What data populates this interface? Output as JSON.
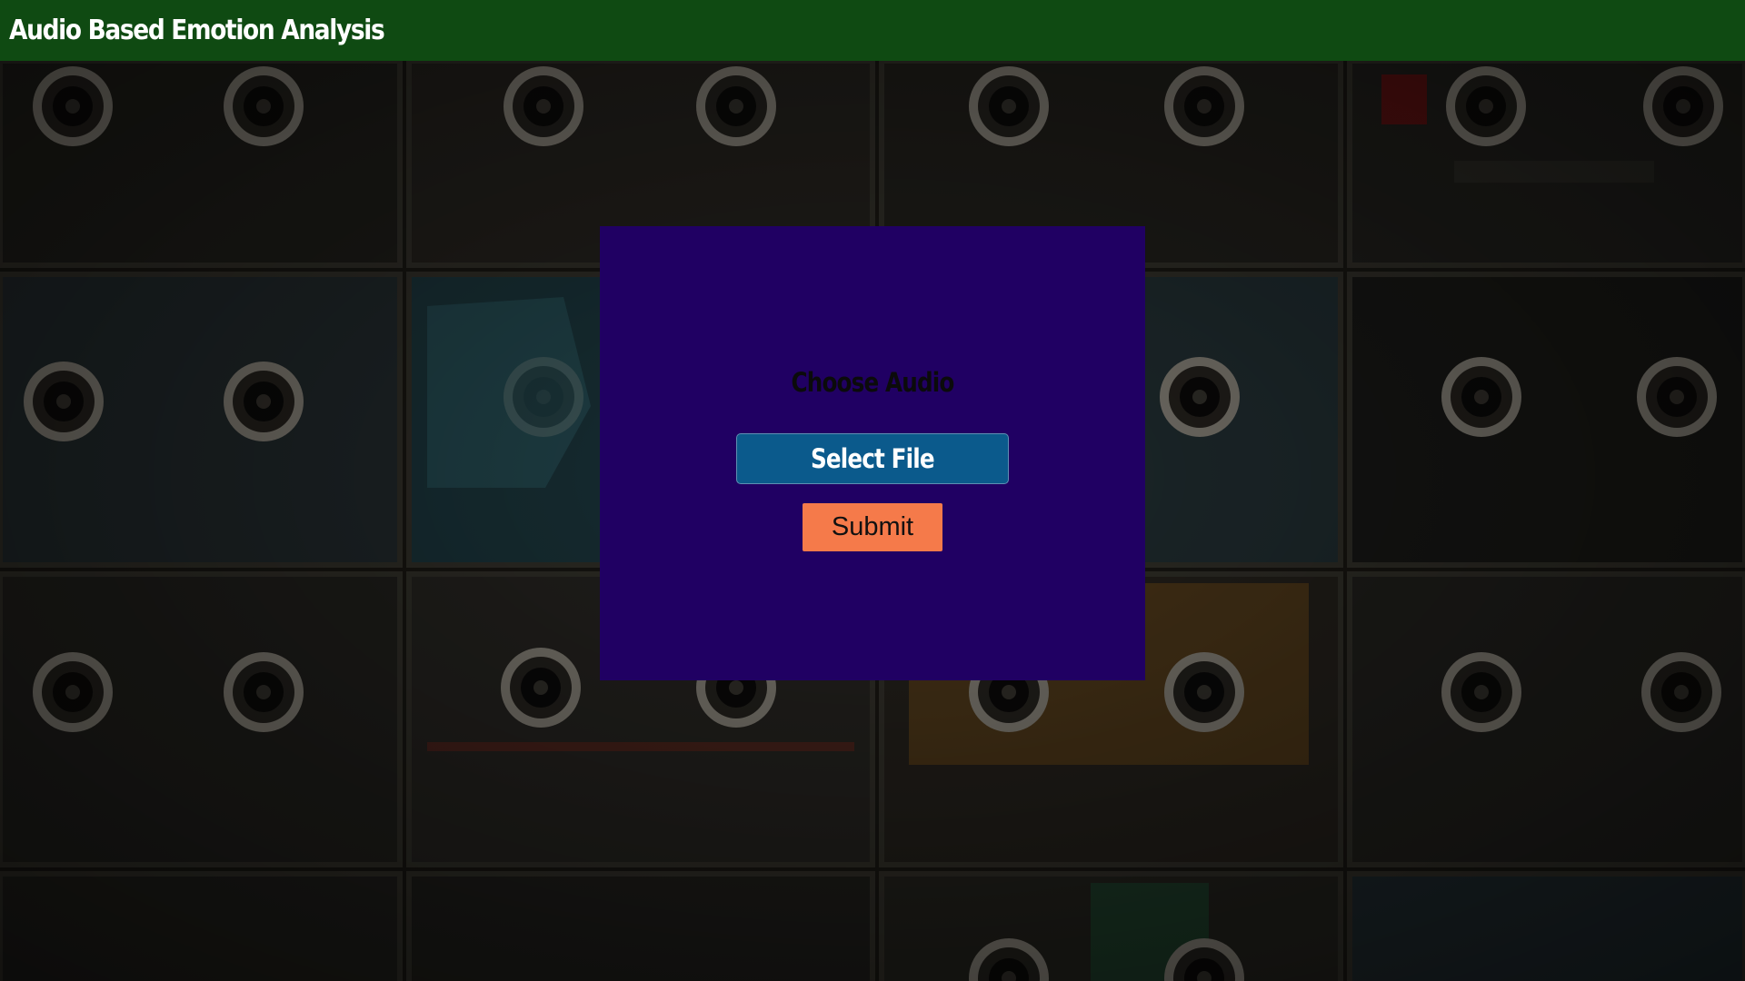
{
  "header": {
    "title": "Audio Based Emotion Analysis",
    "background_color": "#0f4a12"
  },
  "backdrop": {
    "description_icon": "cassette-tapes-background"
  },
  "panel": {
    "title": "Choose Audio",
    "select_file_label": "Select File",
    "submit_label": "Submit",
    "background_color": "#200063",
    "select_file_color": "#0b5a8c",
    "submit_color": "#f57a4a"
  }
}
